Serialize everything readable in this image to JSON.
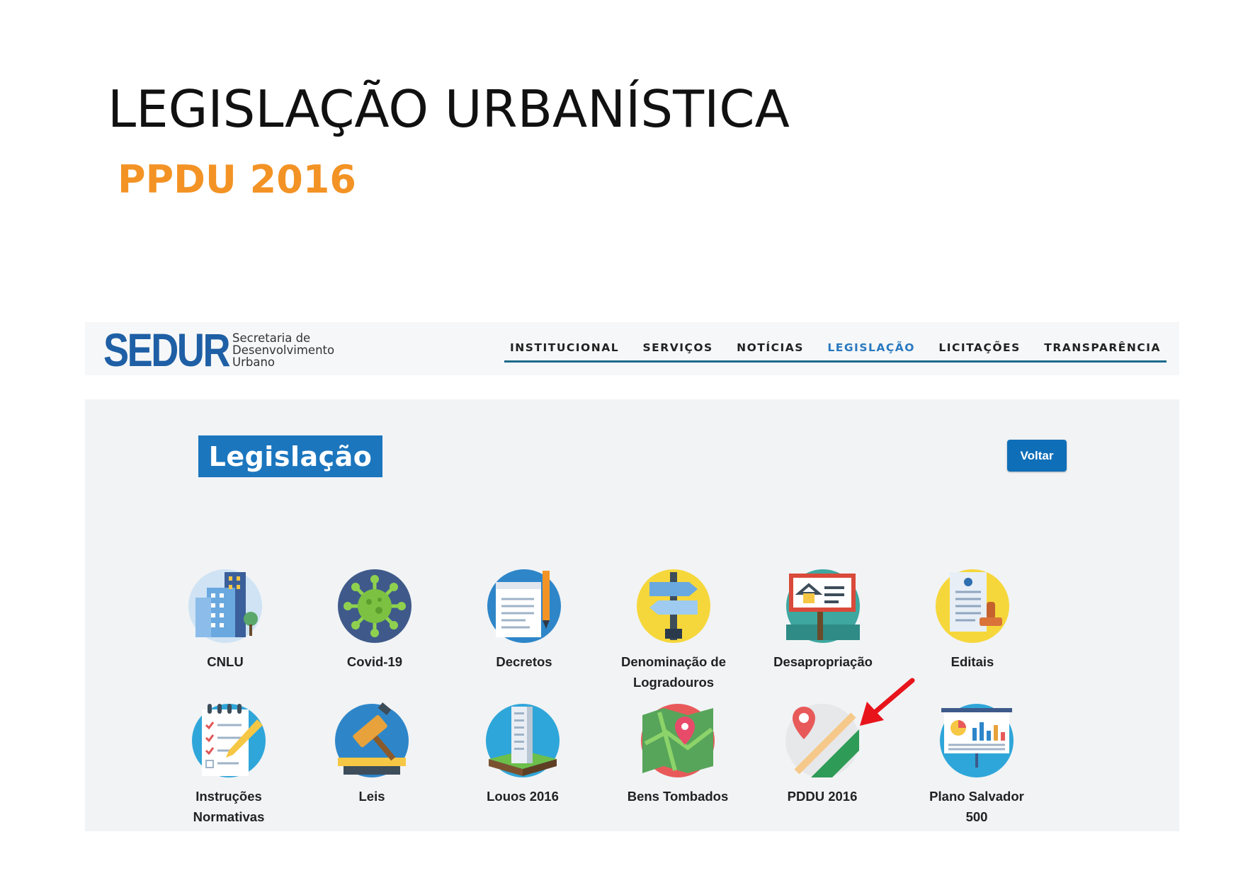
{
  "slide": {
    "title": "LEGISLAÇÃO URBANÍSTICA",
    "subtitle": "PPDU 2016"
  },
  "header": {
    "logo_text": "SEDUR",
    "logo_subtitle_lines": [
      "Secretaria de",
      "Desenvolvimento",
      "Urbano"
    ],
    "nav": [
      {
        "label": "INSTITUCIONAL",
        "active": false
      },
      {
        "label": "SERVIÇOS",
        "active": false
      },
      {
        "label": "NOTÍCIAS",
        "active": false
      },
      {
        "label": "LEGISLAÇÃO",
        "active": true
      },
      {
        "label": "LICITAÇÕES",
        "active": false
      },
      {
        "label": "TRANSPARÊNCIA",
        "active": false
      }
    ]
  },
  "main": {
    "heading": "Legislação",
    "back_label": "Voltar",
    "tiles": [
      {
        "label_lines": [
          "CNLU"
        ],
        "icon": "city-buildings-icon"
      },
      {
        "label_lines": [
          "Covid-19"
        ],
        "icon": "virus-icon"
      },
      {
        "label_lines": [
          "Decretos"
        ],
        "icon": "document-pen-icon"
      },
      {
        "label_lines": [
          "Denominação de",
          "Logradouros"
        ],
        "icon": "signpost-icon"
      },
      {
        "label_lines": [
          "Desapropriação"
        ],
        "icon": "real-estate-sign-icon"
      },
      {
        "label_lines": [
          "Editais"
        ],
        "icon": "stamp-document-icon"
      },
      {
        "label_lines": [
          "Instruções",
          "Normativas"
        ],
        "icon": "checklist-icon"
      },
      {
        "label_lines": [
          "Leis"
        ],
        "icon": "gavel-icon"
      },
      {
        "label_lines": [
          "Louos 2016"
        ],
        "icon": "tower-icon"
      },
      {
        "label_lines": [
          "Bens Tombados"
        ],
        "icon": "map-pin-icon"
      },
      {
        "label_lines": [
          "PDDU 2016"
        ],
        "icon": "location-map-icon"
      },
      {
        "label_lines": [
          "Plano Salvador",
          "500"
        ],
        "icon": "presentation-chart-icon"
      }
    ]
  },
  "colors": {
    "subtitle_orange": "#f39325",
    "brand_blue": "#1e5fa5",
    "heading_blue": "#1b76be",
    "button_blue": "#0f6eb8",
    "nav_active": "#2979c0",
    "arrow_red": "#e8141b"
  },
  "annotation": {
    "icon": "red-arrow-icon",
    "target": "PDDU 2016"
  }
}
